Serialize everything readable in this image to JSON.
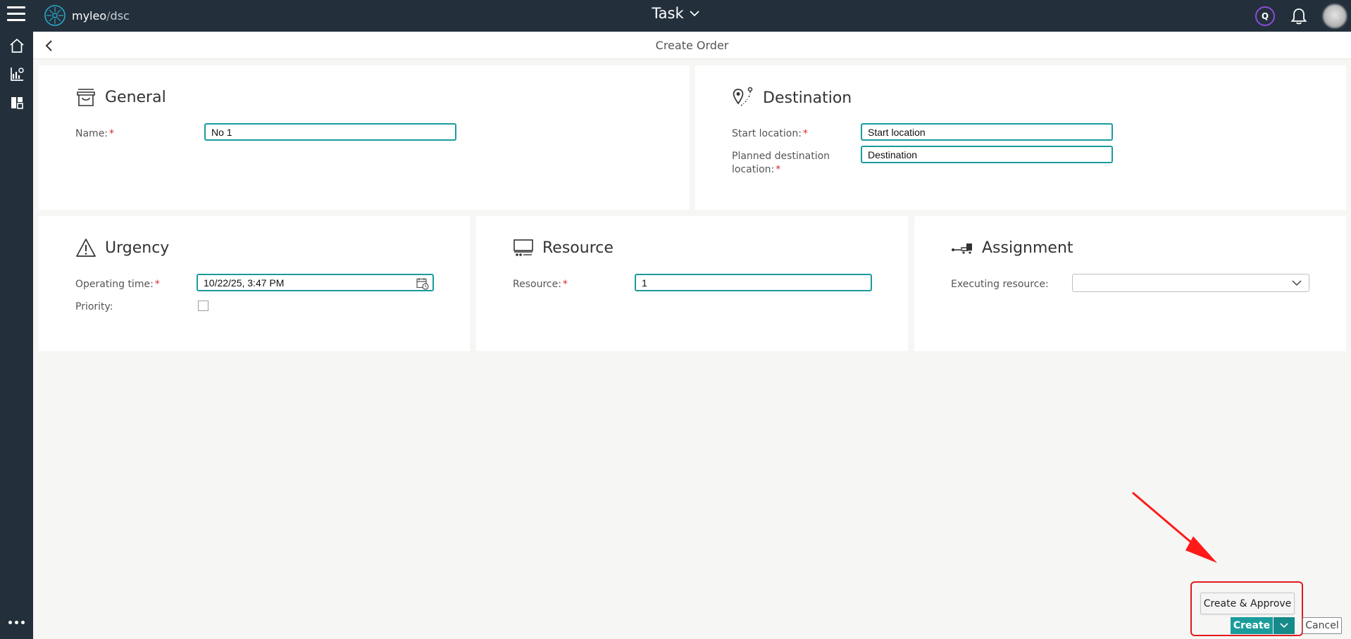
{
  "header": {
    "logo_name": "myleo",
    "logo_separator": "/",
    "logo_product": "dsc",
    "app_title": "Task",
    "user_badge": "Q"
  },
  "page": {
    "title": "Create Order"
  },
  "general": {
    "title": "General",
    "name_label": "Name:",
    "name_value": "No 1"
  },
  "destination": {
    "title": "Destination",
    "start_label": "Start location:",
    "start_value": "Start location",
    "planned_label_line1": "Planned destination",
    "planned_label_line2": "location:",
    "planned_value": "Destination"
  },
  "urgency": {
    "title": "Urgency",
    "operating_label": "Operating time:",
    "operating_value": "10/22/25, 3:47 PM",
    "priority_label": "Priority:",
    "priority_checked": false
  },
  "resource": {
    "title": "Resource",
    "resource_label": "Resource:",
    "resource_value": "1"
  },
  "assignment": {
    "title": "Assignment",
    "executing_label": "Executing resource:",
    "executing_value": ""
  },
  "actions": {
    "create_approve": "Create & Approve",
    "create": "Create",
    "cancel": "Cancel"
  },
  "required_marker": "*",
  "colors": {
    "topbar": "#23303c",
    "accent": "#1a9c9b",
    "required": "#d62b2b",
    "annotation": "#e3181f"
  }
}
